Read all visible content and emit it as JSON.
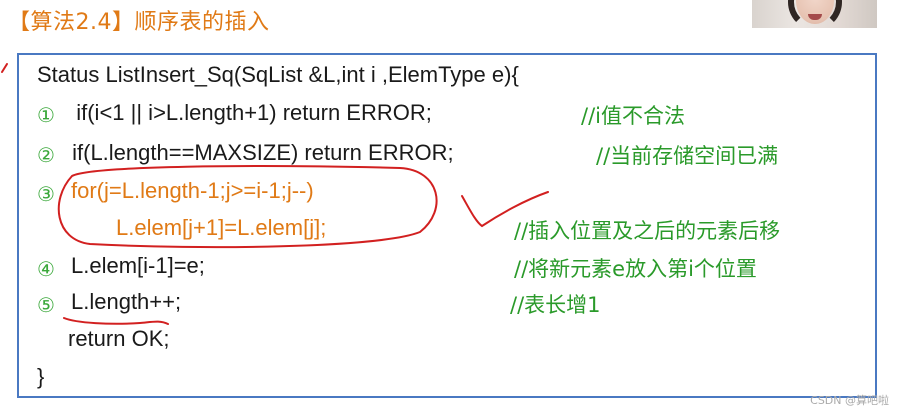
{
  "slide": {
    "title": "【算法2.4】顺序表的插入",
    "watermark": "CSDN @算吧啦"
  },
  "code": {
    "line0": "Status ListInsert_Sq(SqList &L,int i ,ElemType e){",
    "line1_num": "①",
    "line1": "  if(i<1 || i>L.length+1) return ERROR;",
    "line1_comment": "//i值不合法",
    "line2_num": "②",
    "line2": " if(L.length==MAXSIZE) return ERROR;",
    "line2_comment": "//当前存储空间已满",
    "line3_num": "③",
    "line3": "for(j=L.length-1;j>=i-1;j--)",
    "line4": "L.elem[j+1]=L.elem[j];",
    "line4_comment": "//插入位置及之后的元素后移",
    "line5_num": "④",
    "line5": "L.elem[i-1]=e;",
    "line5_comment": "//将新元素e放入第i个位置",
    "line6_num": "⑤",
    "line6": "L.length++;",
    "line6_comment": "//表长增1",
    "line7": "return OK;",
    "line8": "}"
  },
  "colors": {
    "title": "#e07a16",
    "frame_border": "#4a79c2",
    "comment": "#2a9a2a",
    "highlight_code": "#e07a16",
    "annotation": "#d22020"
  }
}
